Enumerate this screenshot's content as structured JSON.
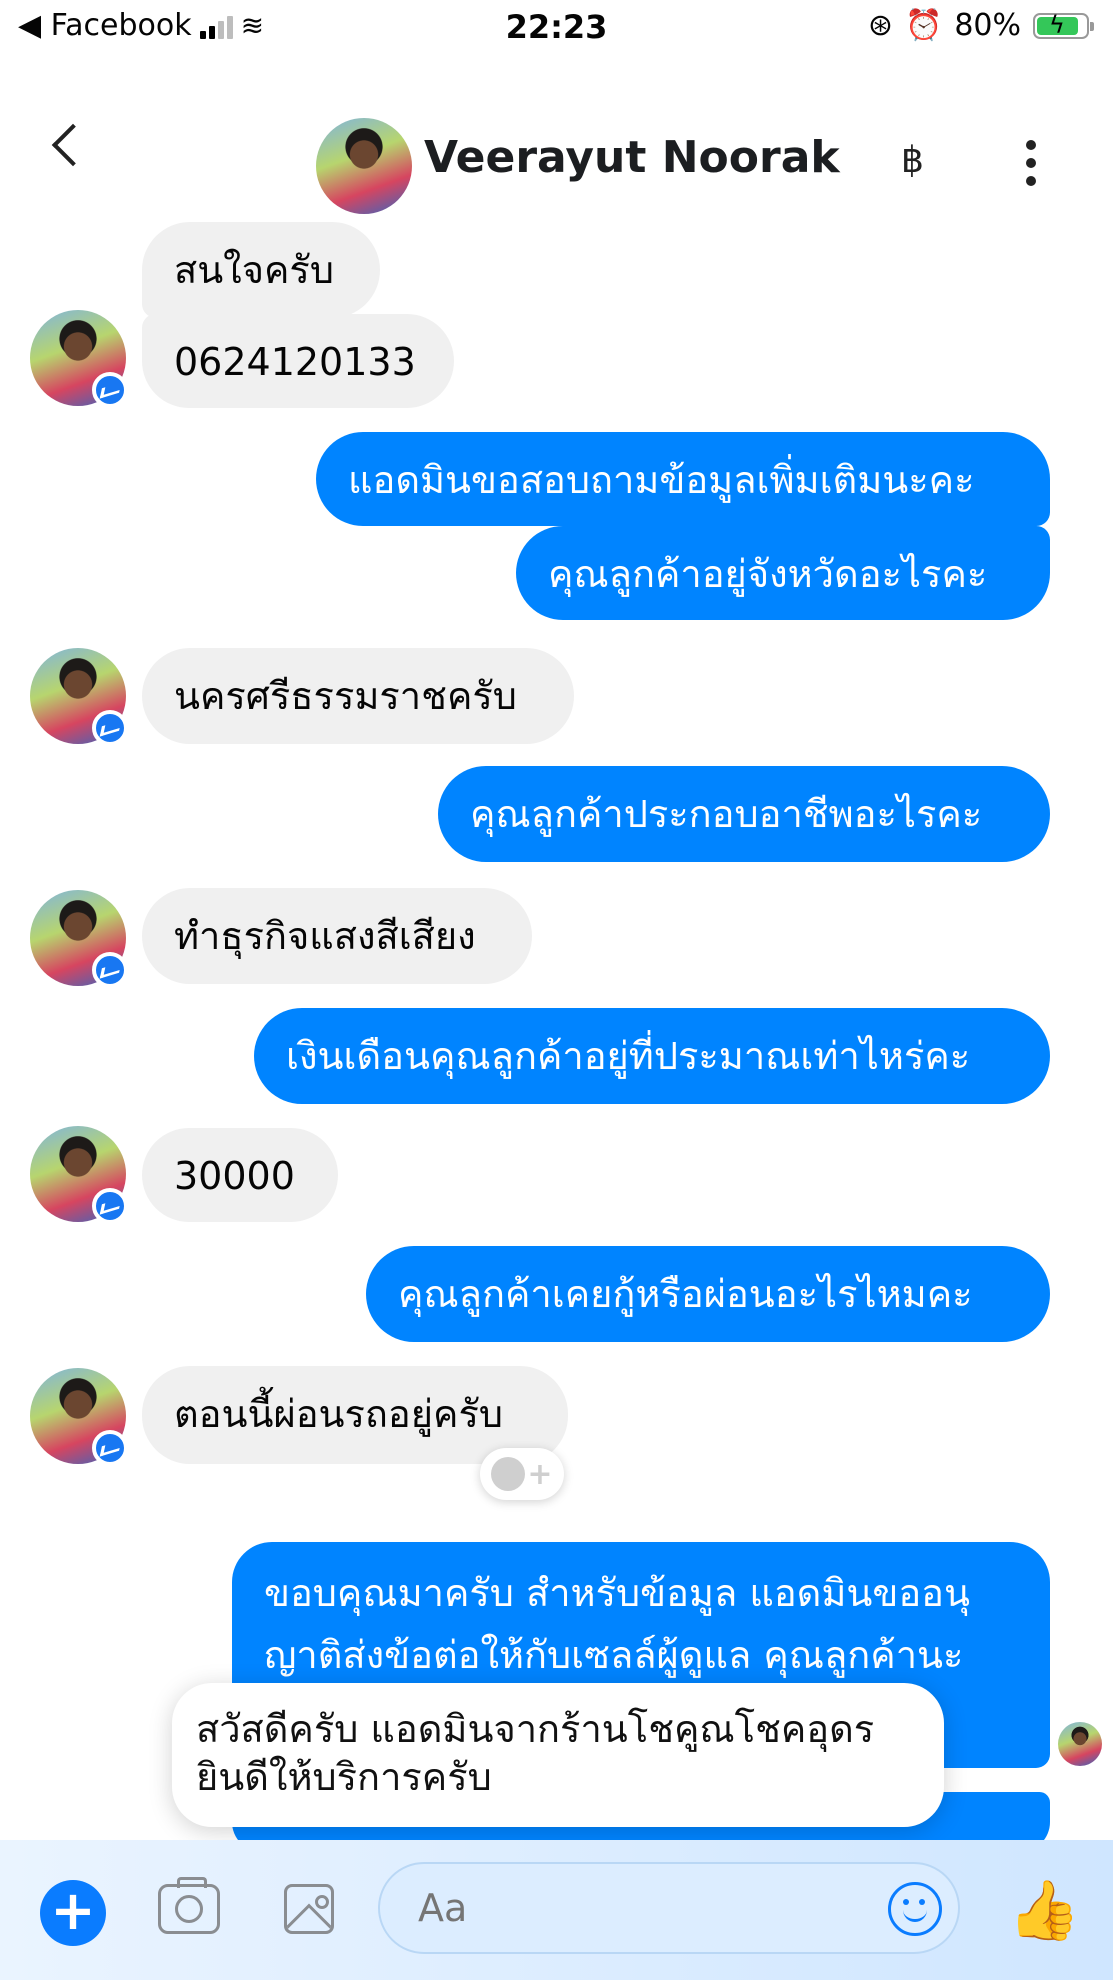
{
  "status_bar": {
    "back_app": "◀ Facebook",
    "time": "22:23",
    "battery": "80%"
  },
  "header": {
    "contact_name": "Veerayut Noorak",
    "currency_icon": "฿"
  },
  "messages": [
    {
      "side": "in",
      "text": "สนใจครับ"
    },
    {
      "side": "in",
      "text": "0624120133"
    },
    {
      "side": "out",
      "text": "แอดมินขอสอบถามข้อมูลเพิ่มเติมนะคะ"
    },
    {
      "side": "out",
      "text": "คุณลูกค้าอยู่จังหวัดอะไรคะ"
    },
    {
      "side": "in",
      "text": "นครศรีธรรมราชครับ"
    },
    {
      "side": "out",
      "text": "คุณลูกค้าประกอบอาชีพอะไรคะ"
    },
    {
      "side": "in",
      "text": "ทำธุรกิจแสงสีเสียง"
    },
    {
      "side": "out",
      "text": "เงินเดือนคุณลูกค้าอยู่ที่ประมาณเท่าไหร่คะ"
    },
    {
      "side": "in",
      "text": "30000"
    },
    {
      "side": "out",
      "text": "คุณลูกค้าเคยกู้หรือผ่อนอะไรไหมคะ"
    },
    {
      "side": "in",
      "text": "ตอนนี้ผ่อนรถอยู่ครับ"
    },
    {
      "side": "out",
      "lines": [
        "ขอบคุณมาครับ สำหรับข้อมูล แอดมินขออนุ",
        "ญาติส่งข้อต่อให้กับเซลล์ผู้ดูแล คุณลูกค้านะ"
      ]
    }
  ],
  "tooltip": {
    "line1": "สวัสดีครับ แอดมินจากร้านโชคูณโชคอุดร",
    "line2": "ยินดีให้บริการครับ"
  },
  "composer": {
    "placeholder": "Aa"
  },
  "colors": {
    "accent": "#0084ff",
    "incoming_bubble": "#f0f0f0"
  }
}
